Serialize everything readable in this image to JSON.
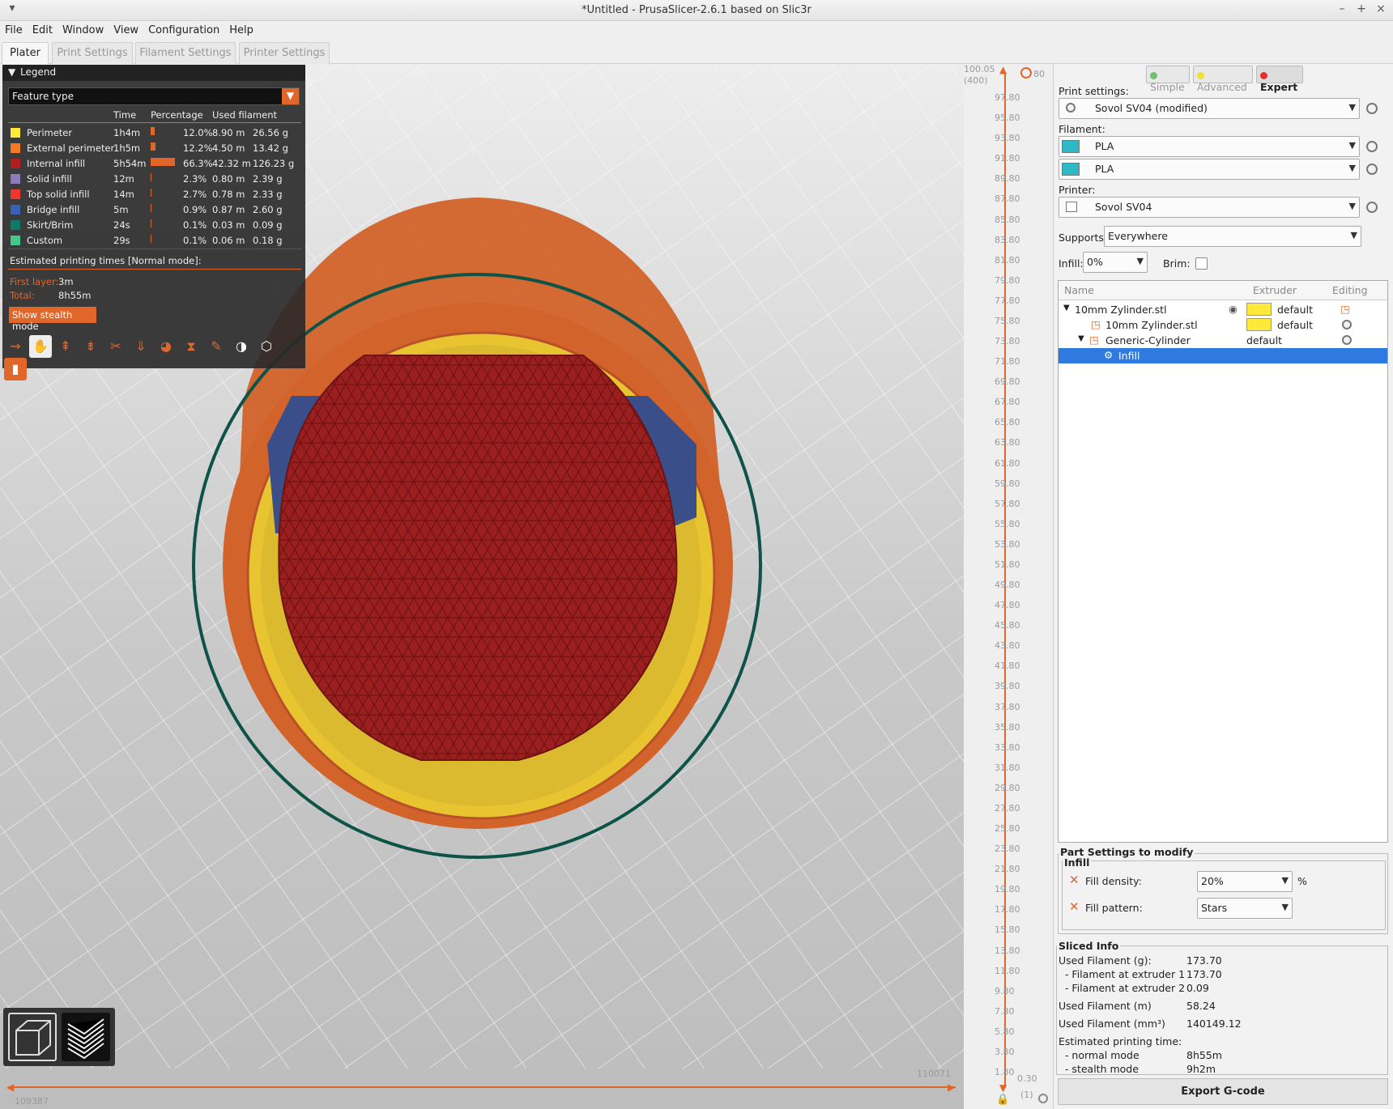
{
  "window": {
    "title": "*Untitled - PrusaSlicer-2.6.1 based on Slic3r",
    "controls": [
      "–",
      "+",
      "×"
    ]
  },
  "menu": [
    "File",
    "Edit",
    "Window",
    "View",
    "Configuration",
    "Help"
  ],
  "tabs": [
    "Plater",
    "Print Settings",
    "Filament Settings",
    "Printer Settings"
  ],
  "legend": {
    "title": "Legend",
    "view_type": "Feature type",
    "columns": [
      "Time",
      "Percentage",
      "Used filament"
    ],
    "rows": [
      {
        "name": "Perimeter",
        "color": "#fee93b",
        "time": "1h4m",
        "pct": "12.0%",
        "pct_value": 12.0,
        "len": "8.90 m",
        "mass": "26.56 g"
      },
      {
        "name": "External perimeter",
        "color": "#f37a1f",
        "time": "1h5m",
        "pct": "12.2%",
        "pct_value": 12.2,
        "len": "4.50 m",
        "mass": "13.42 g"
      },
      {
        "name": "Internal infill",
        "color": "#b01e1e",
        "time": "5h54m",
        "pct": "66.3%",
        "pct_value": 66.3,
        "len": "42.32 m",
        "mass": "126.23 g"
      },
      {
        "name": "Solid infill",
        "color": "#8d7cbb",
        "time": "12m",
        "pct": "2.3%",
        "pct_value": 2.3,
        "len": "0.80 m",
        "mass": "2.39 g"
      },
      {
        "name": "Top solid infill",
        "color": "#f23530",
        "time": "14m",
        "pct": "2.7%",
        "pct_value": 2.7,
        "len": "0.78 m",
        "mass": "2.33 g"
      },
      {
        "name": "Bridge infill",
        "color": "#3b60b8",
        "time": "5m",
        "pct": "0.9%",
        "pct_value": 0.9,
        "len": "0.87 m",
        "mass": "2.60 g"
      },
      {
        "name": "Skirt/Brim",
        "color": "#0f7a68",
        "time": "24s",
        "pct": "0.1%",
        "pct_value": 0.1,
        "len": "0.03 m",
        "mass": "0.09 g"
      },
      {
        "name": "Custom",
        "color": "#43c98b",
        "time": "29s",
        "pct": "0.1%",
        "pct_value": 0.1,
        "len": "0.06 m",
        "mass": "0.18 g"
      }
    ],
    "estimated_header": "Estimated printing times [Normal mode]:",
    "first_layer_label": "First layer:",
    "first_layer": "3m",
    "total_label": "Total:",
    "total": "8h55m",
    "stealth_button": "Show stealth mode"
  },
  "vertical_slider": {
    "top_value": "100.05",
    "top_layer": "(400)",
    "bottom_value": "0.30",
    "bottom_layer": "(1)",
    "ticks": [
      "97.80",
      "95.80",
      "93.80",
      "91.80",
      "89.80",
      "87.80",
      "85.80",
      "83.80",
      "81.80",
      "79.80",
      "77.80",
      "75.80",
      "73.80",
      "71.80",
      "69.80",
      "67.80",
      "65.80",
      "63.80",
      "61.80",
      "59.80",
      "57.80",
      "55.80",
      "53.80",
      "51.80",
      "49.80",
      "47.80",
      "45.80",
      "43.80",
      "41.80",
      "39.80",
      "37.80",
      "35.80",
      "33.80",
      "31.80",
      "29.80",
      "27.80",
      "25.80",
      "23.80",
      "21.80",
      "19.80",
      "17.80",
      "15.80",
      "13.80",
      "11.80",
      "9.80",
      "7.80",
      "5.80",
      "3.80",
      "1.80"
    ],
    "top_right_label": "80"
  },
  "horizontal_slider": {
    "right_value": "110071",
    "left_value": "109387"
  },
  "mode": {
    "simple": "Simple",
    "advanced": "Advanced",
    "expert": "Expert"
  },
  "print_settings": {
    "label": "Print settings:",
    "value": "Sovol SV04 (modified)"
  },
  "filament": {
    "label": "Filament:",
    "values": [
      "PLA",
      "PLA"
    ]
  },
  "printer": {
    "label": "Printer:",
    "value": "Sovol SV04"
  },
  "supports": {
    "label": "Supports:",
    "value": "Everywhere"
  },
  "infill": {
    "label": "Infill:",
    "value": "0%"
  },
  "brim": {
    "label": "Brim:"
  },
  "objects": {
    "headers": [
      "Name",
      "Extruder",
      "Editing"
    ],
    "rows": [
      {
        "name": "10mm Zylinder.stl",
        "extruder": "default"
      },
      {
        "name": "10mm Zylinder.stl",
        "extruder": "default"
      },
      {
        "name": "Generic-Cylinder",
        "extruder": "default"
      },
      {
        "name": "Infill",
        "extruder": ""
      }
    ]
  },
  "part_settings": {
    "title": "Part Settings to modify",
    "group": "Infill",
    "fill_density_label": "Fill density:",
    "fill_density": "20%",
    "fill_density_unit": "%",
    "fill_pattern_label": "Fill pattern:",
    "fill_pattern": "Stars"
  },
  "sliced_info": {
    "title": "Sliced Info",
    "rows": [
      {
        "label": "Used Filament (g):",
        "value": "173.70"
      },
      {
        "label": "  - Filament at extruder 1",
        "value": "173.70"
      },
      {
        "label": "  - Filament at extruder 2",
        "value": "0.09"
      },
      {
        "label": "Used Filament (m)",
        "value": "58.24"
      },
      {
        "label": "Used Filament (mm³)",
        "value": "140149.12"
      },
      {
        "label": "Estimated printing time:",
        "value": ""
      },
      {
        "label": "  - normal mode",
        "value": "8h55m"
      },
      {
        "label": "  - stealth mode",
        "value": "9h2m"
      }
    ]
  },
  "export_button": "Export G-code"
}
